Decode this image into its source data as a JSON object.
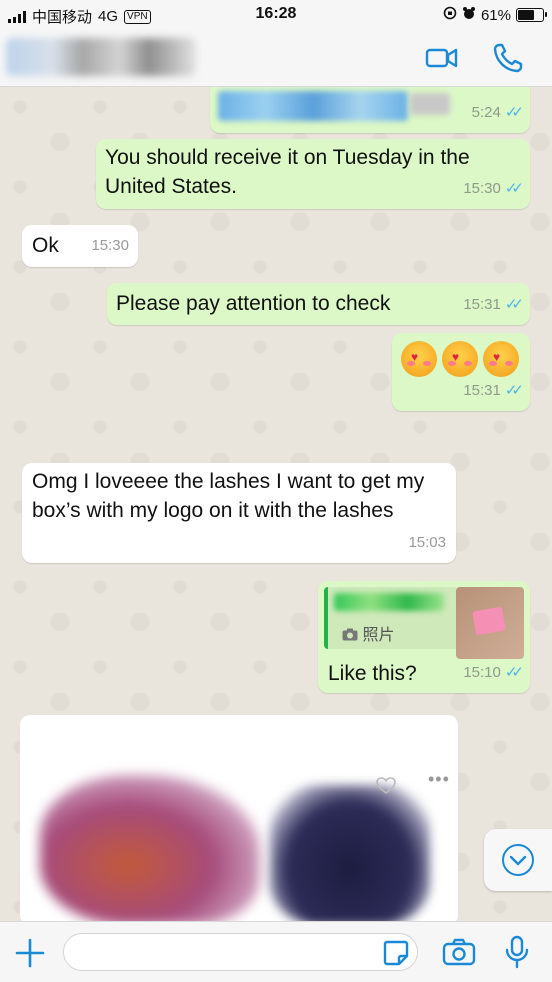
{
  "status_bar": {
    "carrier": "中国移动",
    "network": "4G",
    "vpn": "VPN",
    "time": "16:28",
    "battery": "61%"
  },
  "header": {
    "contact_name_redacted": true,
    "icons": [
      "video-call-icon",
      "phone-icon"
    ],
    "accent_color": "#1a8ad6"
  },
  "messages": [
    {
      "id": "m0",
      "side": "outgoing",
      "text_redacted": true,
      "time": "5:24",
      "status": "read"
    },
    {
      "id": "m1",
      "side": "outgoing",
      "text": "You should receive it on Tuesday in the United States.",
      "time": "15:30",
      "status": "read"
    },
    {
      "id": "m2",
      "side": "incoming",
      "text": "Ok",
      "time": "15:30"
    },
    {
      "id": "m3",
      "side": "outgoing",
      "text": "Please pay attention to check",
      "time": "15:31",
      "status": "read"
    },
    {
      "id": "m4",
      "side": "outgoing",
      "emoji": [
        "smiling-face-with-hearts",
        "smiling-face-with-hearts",
        "smiling-face-with-hearts"
      ],
      "time": "15:31",
      "status": "read"
    },
    {
      "id": "m5",
      "side": "incoming",
      "text": "Omg I loveeee the lashes I want to get my box’s  with my logo on it with the lashes",
      "time": "15:03"
    },
    {
      "id": "m6",
      "side": "outgoing",
      "reply_quote": {
        "label": "照片",
        "icon": "camera-icon"
      },
      "text": "Like this?",
      "time": "15:10",
      "status": "read"
    },
    {
      "id": "m7",
      "side": "incoming",
      "type": "image",
      "redacted": true
    }
  ],
  "input_bar": {
    "placeholder": "",
    "icons": [
      "plus-icon",
      "sticker-icon",
      "camera-icon",
      "microphone-icon"
    ]
  },
  "colors": {
    "outgoing_bubble": "#dcf8c6",
    "incoming_bubble": "#ffffff",
    "chat_background": "#e9e4dc",
    "read_ticks": "#4fb6ec"
  }
}
